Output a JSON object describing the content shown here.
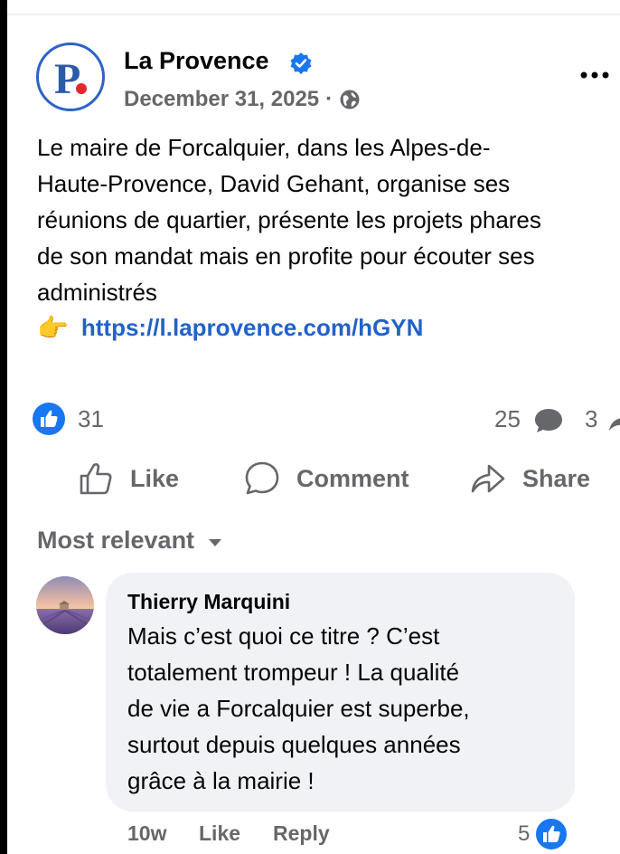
{
  "colors": {
    "brand_blue": "#1877f2",
    "link": "#2362c8",
    "muted": "#65676b",
    "bubble": "#f0f2f5"
  },
  "post": {
    "page_name": "La Provence",
    "date": "December 31, 2025",
    "separator": "·",
    "text": "Le maire de Forcalquier, dans les Alpes-de-\nHaute-Provence, David Gehant, organise ses\nréunions de quartier, présente les projets phares\nde son mandat mais en profite pour écouter ses\nadministrés",
    "pointer_emoji": "👉",
    "link": "https://l.laprovence.com/hGYN"
  },
  "stats": {
    "reactions": "31",
    "comments": "25",
    "shares": "3"
  },
  "actions": {
    "like": "Like",
    "comment": "Comment",
    "share": "Share"
  },
  "sort": {
    "label": "Most relevant"
  },
  "comment": {
    "author": "Thierry Marquini",
    "text": "Mais c’est quoi ce titre ? C’est\ntotalement trompeur ! La qualité\nde vie a Forcalquier est superbe,\nsurtout depuis quelques années\ngrâce à la mairie !",
    "time": "10w",
    "like_label": "Like",
    "reply_label": "Reply",
    "reaction_count": "5"
  },
  "icons": [
    "verified-badge-icon",
    "more-icon",
    "globe-icon",
    "like-reaction-icon",
    "comment-bubble-icon",
    "share-arrow-icon",
    "thumbs-up-icon",
    "comment-icon",
    "share-icon",
    "chevron-down-icon"
  ]
}
